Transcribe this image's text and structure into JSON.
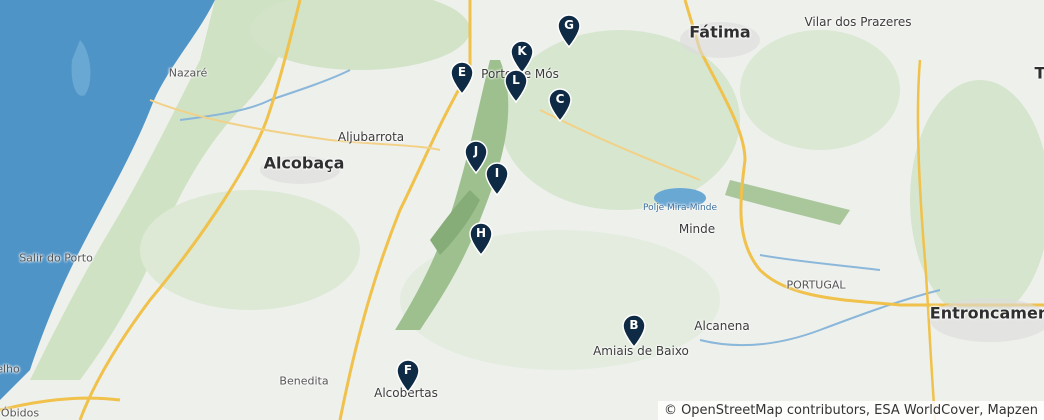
{
  "map": {
    "places": [
      {
        "name": "Nazaré",
        "size": "small"
      },
      {
        "name": "Aljubarrota",
        "size": "med"
      },
      {
        "name": "Alcobaça",
        "size": "big"
      },
      {
        "name": "Salir do Porto",
        "size": "small"
      },
      {
        "name": "Porto de Mós",
        "size": "med"
      },
      {
        "name": "Fátima",
        "size": "big"
      },
      {
        "name": "Vilar dos Prazeres",
        "size": "med"
      },
      {
        "name": "Polje Mira-Minde",
        "size": "lake"
      },
      {
        "name": "Minde",
        "size": "med"
      },
      {
        "name": "PORTUGAL",
        "size": "small"
      },
      {
        "name": "Alcanena",
        "size": "med"
      },
      {
        "name": "Amiais de Baixo",
        "size": "med"
      },
      {
        "name": "Entroncamento",
        "size": "big"
      },
      {
        "name": "Benedita",
        "size": "small"
      },
      {
        "name": "Alcobertas",
        "size": "med"
      },
      {
        "name": "elho",
        "size": "small"
      },
      {
        "name": "Óbidos",
        "size": "small"
      },
      {
        "name": "T",
        "size": "big"
      }
    ],
    "markers": [
      "G",
      "K",
      "E",
      "L",
      "C",
      "J",
      "I",
      "H",
      "B",
      "F"
    ],
    "attribution": "© OpenStreetMap contributors, ESA WorldCover, Mapzen",
    "colors": {
      "water": "#4f94c7",
      "land": "#eef0ec",
      "forest": "#d2e3c8",
      "ridge": "#9dc08e",
      "road": "#f0c14b",
      "marker": "#0f2a44"
    }
  }
}
